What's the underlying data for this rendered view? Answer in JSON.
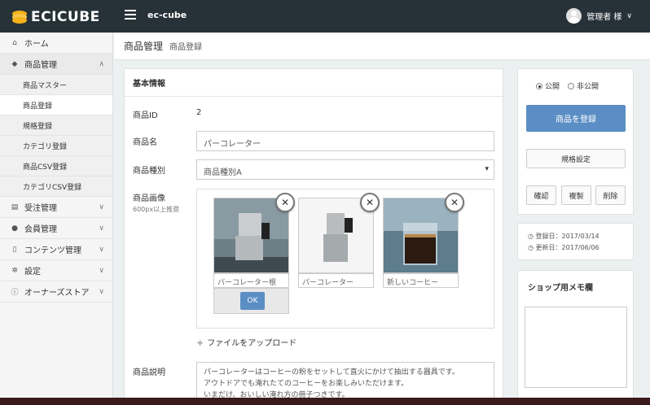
{
  "header": {
    "logo_text": "ECICUBE",
    "shop_name": "ec-cube",
    "user_name": "管理者 様"
  },
  "sidebar": {
    "items": [
      {
        "label": "ホーム",
        "icon": "home-icon"
      },
      {
        "label": "商品管理",
        "icon": "tag-icon",
        "open": true
      },
      {
        "label": "受注管理",
        "icon": "cart-icon"
      },
      {
        "label": "会員管理",
        "icon": "users-icon"
      },
      {
        "label": "コンテンツ管理",
        "icon": "file-icon"
      },
      {
        "label": "設定",
        "icon": "gear-icon"
      },
      {
        "label": "オーナーズストア",
        "icon": "info-icon"
      }
    ],
    "sub_items": [
      "商品マスター",
      "商品登録",
      "規格登録",
      "カテゴリ登録",
      "商品CSV登録",
      "カテゴリCSV登録"
    ]
  },
  "page": {
    "title": "商品管理",
    "subtitle": "商品登録"
  },
  "form": {
    "card_title": "基本情報",
    "id_label": "商品ID",
    "id_value": "2",
    "name_label": "商品名",
    "name_value": "パーコレーター",
    "type_label": "商品種別",
    "type_value": "商品種別A",
    "image_label": "商品画像",
    "image_hint": "600px以上推奨",
    "images": [
      {
        "caption": "パーコレーター根"
      },
      {
        "caption": "パーコレーター"
      },
      {
        "caption": "新しいコーヒー"
      }
    ],
    "ok_label": "OK",
    "upload_label": "ファイルをアップロード",
    "desc_label": "商品説明",
    "desc_lines": [
      "パーコレーターはコーヒーの粉をセットして直火にかけて抽出する器具です。",
      "アウトドアでも淹れたてのコーヒーをお楽しみいただけます。",
      "いまだけ、おいしい淹れ方の冊子つきです。"
    ]
  },
  "status": {
    "public_label": "公開",
    "private_label": "非公開",
    "register_label": "商品を登録",
    "class_label": "規格設定",
    "confirm_label": "確認",
    "copy_label": "複製",
    "delete_label": "削除",
    "created_text": "登録日：2017/03/14",
    "updated_text": "更新日：2017/06/06"
  },
  "memo": {
    "title": "ショップ用メモ欄"
  },
  "colors": {
    "header_bg": "#263238",
    "accent": "#5b8ec4"
  }
}
